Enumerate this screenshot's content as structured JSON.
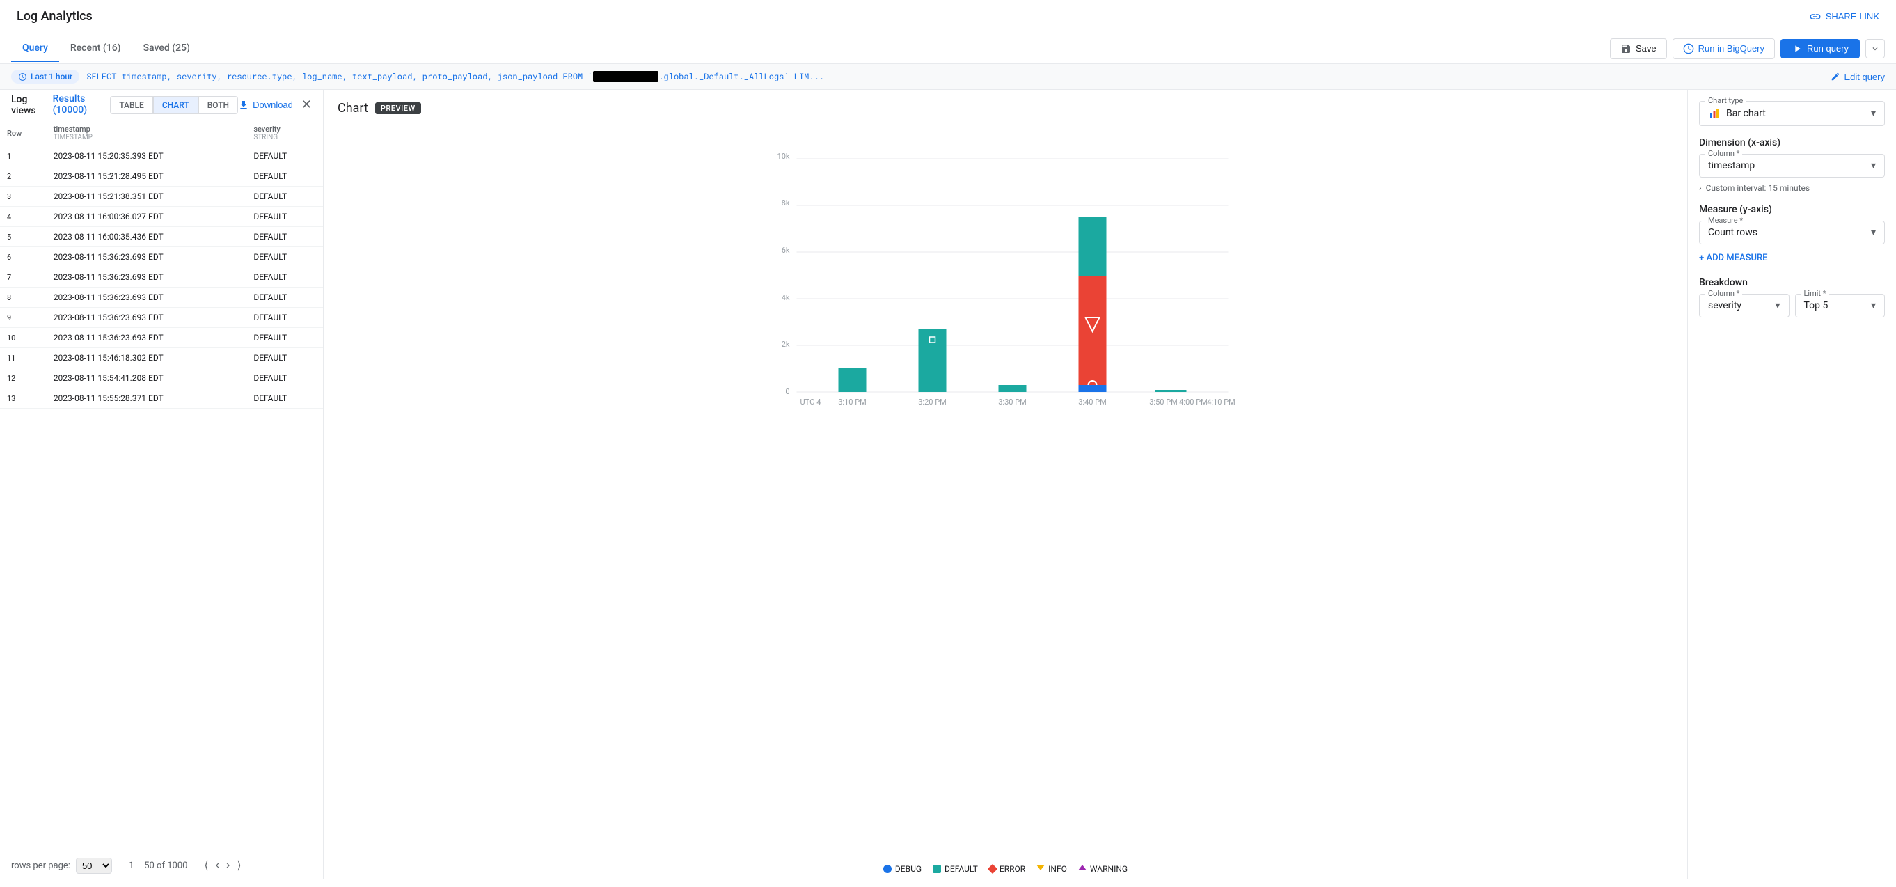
{
  "app": {
    "title": "Log Analytics",
    "share_link_label": "SHARE LINK"
  },
  "tabs": {
    "items": [
      {
        "id": "query",
        "label": "Query",
        "active": true
      },
      {
        "id": "recent",
        "label": "Recent (16)",
        "active": false
      },
      {
        "id": "saved",
        "label": "Saved (25)",
        "active": false
      }
    ],
    "save_label": "Save",
    "run_bigquery_label": "Run in BigQuery",
    "run_query_label": "Run query"
  },
  "query_bar": {
    "time_label": "Last 1 hour",
    "query_text": "SELECT timestamp, severity, resource.type, log_name, text_payload, proto_payload, json_payload FROM `",
    "query_suffix": ".global._Default._AllLogs` LIM...",
    "edit_label": "Edit query"
  },
  "log_views": {
    "label": "Log views",
    "results_label": "Results (10000)",
    "view_types": [
      {
        "id": "table",
        "label": "TABLE"
      },
      {
        "id": "chart",
        "label": "CHART",
        "active": true
      },
      {
        "id": "both",
        "label": "BOTH"
      }
    ],
    "download_label": "Download"
  },
  "table": {
    "columns": [
      {
        "id": "row",
        "label": "Row",
        "type": ""
      },
      {
        "id": "timestamp",
        "label": "timestamp",
        "type": "TIMESTAMP"
      },
      {
        "id": "severity",
        "label": "severity",
        "type": "STRING"
      }
    ],
    "rows": [
      {
        "row": "1",
        "timestamp": "2023-08-11 15:20:35.393 EDT",
        "severity": "DEFAULT"
      },
      {
        "row": "2",
        "timestamp": "2023-08-11 15:21:28.495 EDT",
        "severity": "DEFAULT"
      },
      {
        "row": "3",
        "timestamp": "2023-08-11 15:21:38.351 EDT",
        "severity": "DEFAULT"
      },
      {
        "row": "4",
        "timestamp": "2023-08-11 16:00:36.027 EDT",
        "severity": "DEFAULT"
      },
      {
        "row": "5",
        "timestamp": "2023-08-11 16:00:35.436 EDT",
        "severity": "DEFAULT"
      },
      {
        "row": "6",
        "timestamp": "2023-08-11 15:36:23.693 EDT",
        "severity": "DEFAULT"
      },
      {
        "row": "7",
        "timestamp": "2023-08-11 15:36:23.693 EDT",
        "severity": "DEFAULT"
      },
      {
        "row": "8",
        "timestamp": "2023-08-11 15:36:23.693 EDT",
        "severity": "DEFAULT"
      },
      {
        "row": "9",
        "timestamp": "2023-08-11 15:36:23.693 EDT",
        "severity": "DEFAULT"
      },
      {
        "row": "10",
        "timestamp": "2023-08-11 15:36:23.693 EDT",
        "severity": "DEFAULT"
      },
      {
        "row": "11",
        "timestamp": "2023-08-11 15:46:18.302 EDT",
        "severity": "DEFAULT"
      },
      {
        "row": "12",
        "timestamp": "2023-08-11 15:54:41.208 EDT",
        "severity": "DEFAULT"
      },
      {
        "row": "13",
        "timestamp": "2023-08-11 15:55:28.371 EDT",
        "severity": "DEFAULT"
      }
    ]
  },
  "pagination": {
    "rows_label": "rows per page:",
    "rows_value": "50",
    "range_label": "1 – 50 of 1000"
  },
  "chart": {
    "title": "Chart",
    "preview_label": "PREVIEW",
    "x_labels": [
      "UTC-4",
      "3:10 PM",
      "3:20 PM",
      "3:30 PM",
      "3:40 PM",
      "3:50 PM",
      "4:00 PM",
      "4:10 PM"
    ],
    "y_labels": [
      "0",
      "2k",
      "4k",
      "6k",
      "8k",
      "10k"
    ],
    "legend": [
      {
        "id": "debug",
        "label": "DEBUG",
        "color": "#1a73e8",
        "shape": "circle"
      },
      {
        "id": "default",
        "label": "DEFAULT",
        "color": "#1ba9a0",
        "shape": "square"
      },
      {
        "id": "error",
        "label": "ERROR",
        "color": "#ea4335",
        "shape": "diamond"
      },
      {
        "id": "info",
        "label": "INFO",
        "color": "#f4b400",
        "shape": "triangle-down"
      },
      {
        "id": "warning",
        "label": "WARNING",
        "color": "#9c27b0",
        "shape": "triangle-up"
      }
    ]
  },
  "right_panel": {
    "chart_type_label": "Chart type",
    "chart_type_value": "Bar chart",
    "dimension_label": "Dimension (x-axis)",
    "column_label": "Column *",
    "column_value": "timestamp",
    "custom_interval_label": "Custom interval: 15 minutes",
    "measure_label": "Measure (y-axis)",
    "measure_field_label": "Measure *",
    "measure_value": "Count rows",
    "add_measure_label": "+ ADD MEASURE",
    "breakdown_label": "Breakdown",
    "breakdown_column_label": "Column *",
    "breakdown_column_value": "severity",
    "breakdown_limit_label": "Limit *",
    "breakdown_limit_value": "Top 5"
  }
}
